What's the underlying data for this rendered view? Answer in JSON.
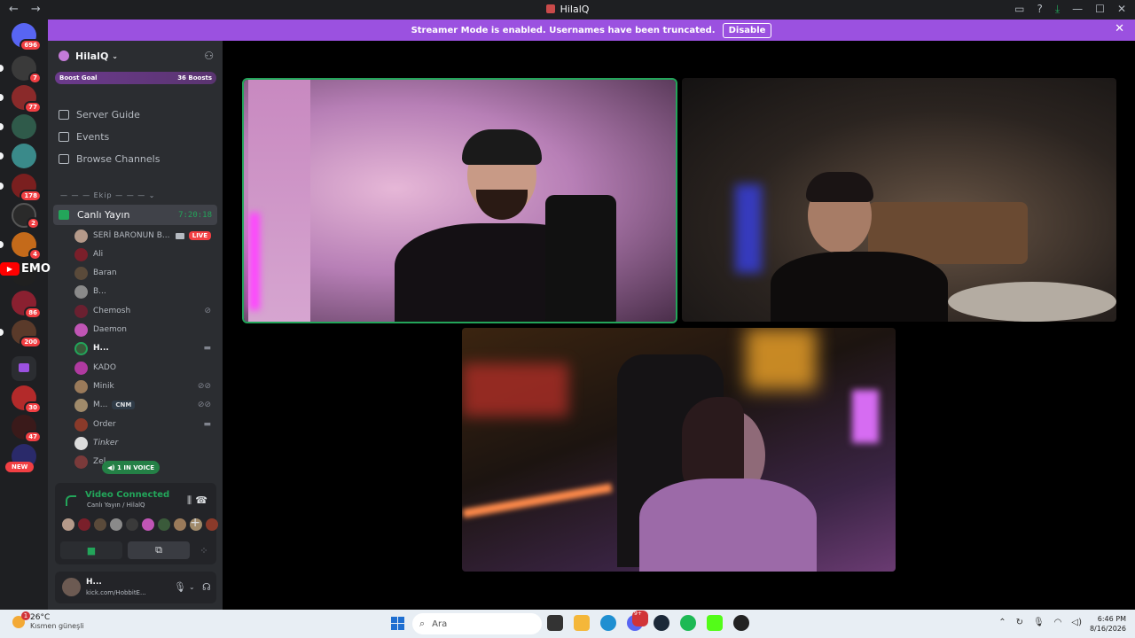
{
  "window": {
    "title": "HilalQ",
    "back": "←",
    "forward": "→"
  },
  "banner": {
    "text": "Streamer Mode is enabled. Usernames have been truncated.",
    "button": "Disable",
    "close": "✕"
  },
  "guild_badges": [
    "696",
    "7",
    "77",
    "",
    "",
    "178",
    "2",
    "4",
    "",
    "86",
    "200",
    "",
    "30",
    "47",
    ""
  ],
  "new_badge": "NEW",
  "youtube_overlay": "EMO",
  "server": {
    "name": "HilalQ",
    "chevron": "⌄",
    "boost_goal": "Boost Goal",
    "boost_count": "36 Boosts"
  },
  "menu": {
    "server_guide": "Server Guide",
    "events": "Events",
    "browse_channels": "Browse Channels"
  },
  "category": "— — — Ekip — — — ⌄",
  "voice_channel": {
    "name": "Canlı Yayın",
    "timer": "7:20:18"
  },
  "members": [
    {
      "name": "SERİ BARONUN B...",
      "live": "LIVE"
    },
    {
      "name": "Ali"
    },
    {
      "name": "Baran"
    },
    {
      "name": "B..."
    },
    {
      "name": "Chemosh"
    },
    {
      "name": "Daemon"
    },
    {
      "name": "H..."
    },
    {
      "name": "KADO"
    },
    {
      "name": "Minik"
    },
    {
      "name": "M...",
      "tag": "CNM"
    },
    {
      "name": "Order"
    },
    {
      "name": "Tinker"
    },
    {
      "name": "Zel..."
    }
  ],
  "in_voice": "1 IN VOICE",
  "voice_panel": {
    "status": "Video Connected",
    "location": "Canlı Yayın / HilalQ",
    "add": "+"
  },
  "user": {
    "name": "H...",
    "status": "kick.com/HobbitE..."
  },
  "taskbar": {
    "temperature": "26°C",
    "weather": "Kısmen güneşli",
    "notification_count": "1",
    "search_placeholder": "Ara",
    "time": "6:46 PM",
    "date": "8/16/2026",
    "discord_badge": "9+"
  },
  "colors": {
    "accent": "#9b51e0",
    "online": "#23a55a",
    "danger": "#f23f43"
  }
}
